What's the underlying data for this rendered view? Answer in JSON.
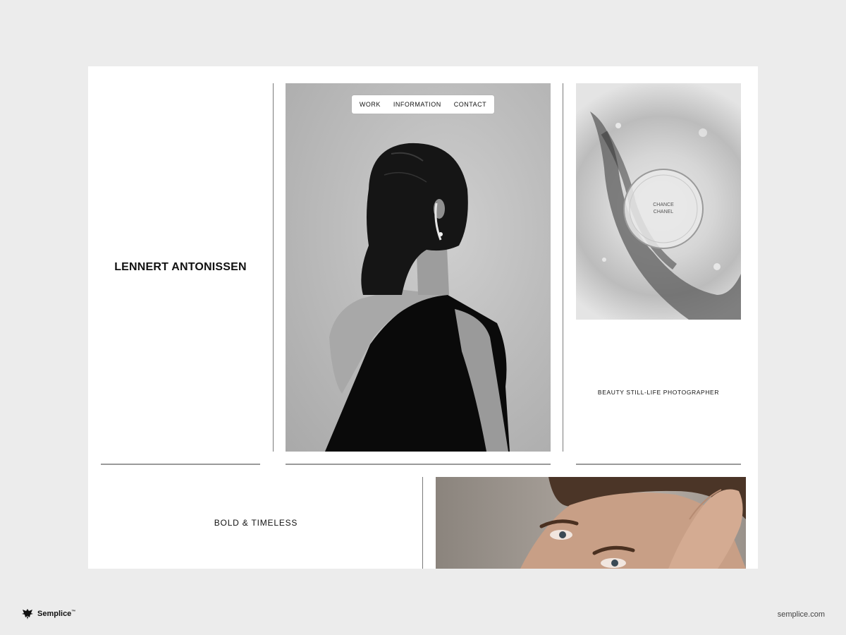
{
  "site": {
    "title": "LENNERT ANTONISSEN",
    "tagline": "BEAUTY STILL-LIFE PHOTOGRAPHER",
    "section_heading": "BOLD & TIMELESS"
  },
  "nav": {
    "items": [
      {
        "label": "WORK"
      },
      {
        "label": "INFORMATION"
      },
      {
        "label": "CONTACT"
      }
    ]
  },
  "images": {
    "hero": {
      "icon": "woman-back-portrait-photo",
      "tone": "grayscale"
    },
    "perfume": {
      "icon": "perfume-bottle-in-ice-photo",
      "label_line1": "CHANCE",
      "label_line2": "CHANEL"
    },
    "portrait": {
      "icon": "woman-face-close-up-photo"
    }
  },
  "footer": {
    "brand": "Semplice",
    "brand_tm": "™",
    "url": "semplice.com"
  },
  "colors": {
    "background": "#ececec",
    "page": "#ffffff",
    "text": "#111111",
    "divider": "#7a7a7a"
  }
}
